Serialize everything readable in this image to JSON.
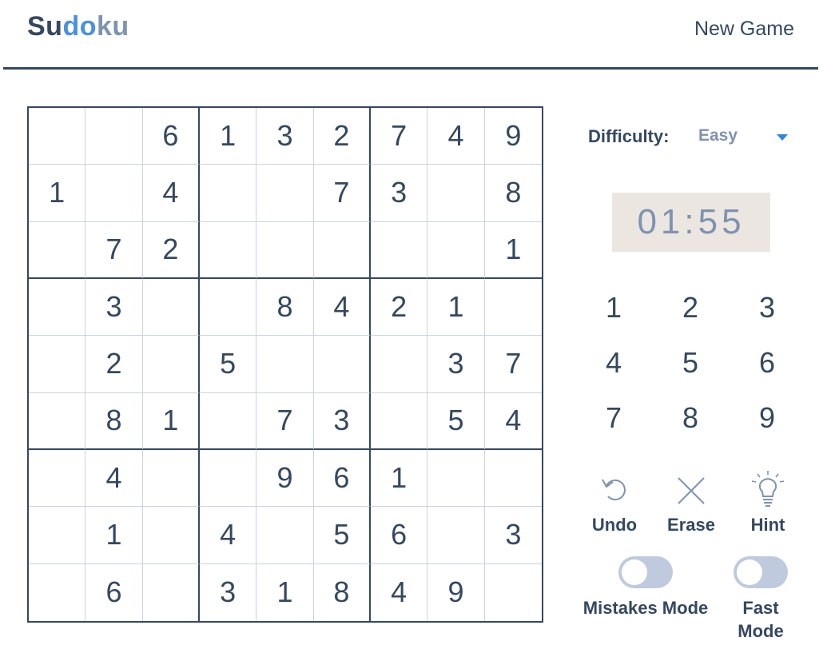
{
  "header": {
    "logo_part1": "Su",
    "logo_part2": "do",
    "logo_part3": "ku",
    "new_game_label": "New Game"
  },
  "board": [
    [
      "",
      "",
      "6",
      "1",
      "3",
      "2",
      "7",
      "4",
      "9"
    ],
    [
      "1",
      "",
      "4",
      "",
      "",
      "7",
      "3",
      "",
      "8"
    ],
    [
      "",
      "7",
      "2",
      "",
      "",
      "",
      "",
      "",
      "1"
    ],
    [
      "",
      "3",
      "",
      "",
      "8",
      "4",
      "2",
      "1",
      ""
    ],
    [
      "",
      "2",
      "",
      "5",
      "",
      "",
      "",
      "3",
      "7"
    ],
    [
      "",
      "8",
      "1",
      "",
      "7",
      "3",
      "",
      "5",
      "4"
    ],
    [
      "",
      "4",
      "",
      "",
      "9",
      "6",
      "1",
      "",
      ""
    ],
    [
      "",
      "1",
      "",
      "4",
      "",
      "5",
      "6",
      "",
      "3"
    ],
    [
      "",
      "6",
      "",
      "3",
      "1",
      "8",
      "4",
      "9",
      ""
    ]
  ],
  "controls": {
    "difficulty_label": "Difficulty:",
    "difficulty_value": "Easy",
    "timer": "01:55",
    "numpad": [
      "1",
      "2",
      "3",
      "4",
      "5",
      "6",
      "7",
      "8",
      "9"
    ],
    "undo_label": "Undo",
    "erase_label": "Erase",
    "hint_label": "Hint",
    "mistakes_mode_label": "Mistakes Mode",
    "mistakes_mode_on": false,
    "fast_mode_label_line1": "Fast",
    "fast_mode_label_line2": "Mode",
    "fast_mode_on": false
  },
  "colors": {
    "primary": "#344861",
    "logo_blue": "#4a90e2",
    "muted": "#7d93b2",
    "caret": "#2e86de",
    "timer_bg": "#ece6e1",
    "toggle_off": "#bfcade"
  },
  "icons": {
    "undo": "undo-icon",
    "erase": "erase-icon",
    "hint": "lightbulb-icon",
    "difficulty": "caret-down-icon"
  }
}
